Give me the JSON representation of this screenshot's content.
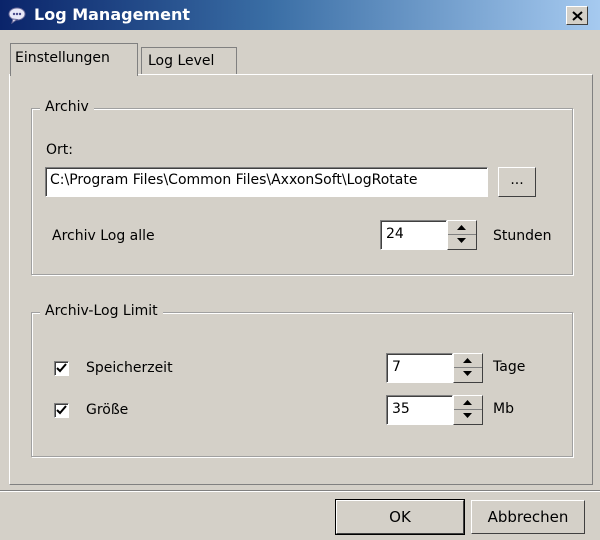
{
  "window": {
    "title": "Log Management",
    "close_glyph": "X",
    "app_icon": "chat-bubble-icon"
  },
  "tabs": [
    {
      "label": "Einstellungen",
      "active": true
    },
    {
      "label": "Log Level",
      "active": false
    }
  ],
  "archive": {
    "group_label": "Archiv",
    "location_label": "Ort:",
    "path_value": "C:\\Program Files\\Common Files\\AxxonSoft\\LogRotate",
    "browse_label": "...",
    "interval_label": "Archiv Log alle",
    "interval_value": "24",
    "interval_unit": "Stunden"
  },
  "limit": {
    "group_label": "Archiv-Log Limit",
    "retention": {
      "label": "Speicherzeit",
      "checked": true,
      "value": "7",
      "unit": "Tage"
    },
    "size": {
      "label": "Größe",
      "checked": true,
      "value": "35",
      "unit": "Mb"
    }
  },
  "footer": {
    "ok_label": "OK",
    "cancel_label": "Abbrechen"
  }
}
